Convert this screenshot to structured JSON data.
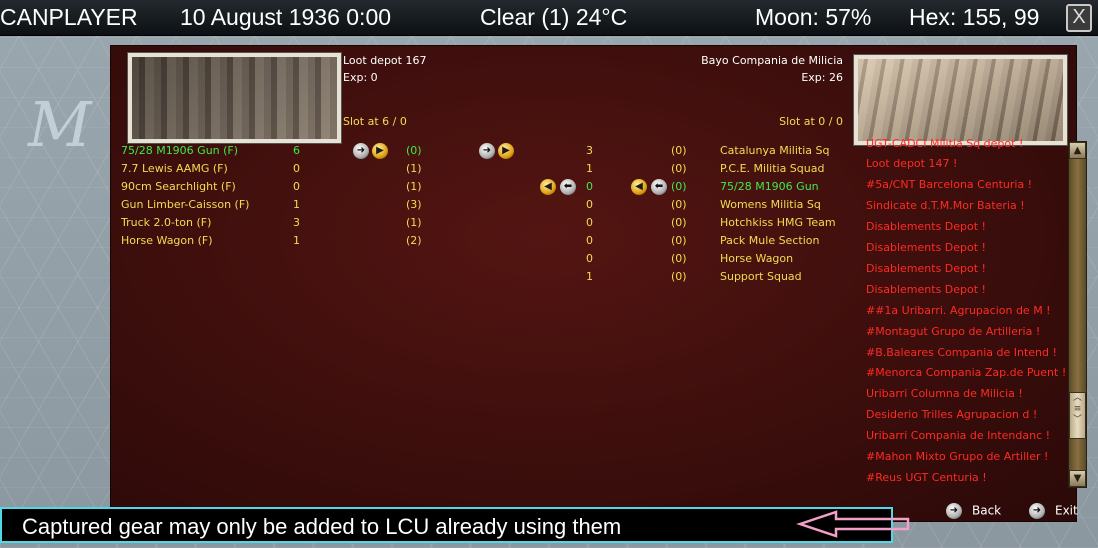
{
  "topbar": {
    "player": "CANPLAYER",
    "date": "10 August 1936 0:00",
    "weather": "Clear (1) 24°C",
    "moon": "Moon: 57%",
    "hex": "Hex: 155, 99",
    "close_icon": "X"
  },
  "map": {
    "letter": "M"
  },
  "source_unit": {
    "name": "Loot depot 167",
    "exp": "Exp: 0",
    "slots": "Slot at 6 / 0"
  },
  "target_unit": {
    "name": "Bayo Compania de Milicia",
    "exp": "Exp: 26",
    "slots": "Slot at 0 / 0"
  },
  "left_rows": [
    {
      "name": "75/28 M1906 Gun (F)",
      "qty": "6",
      "cnt": "(0)",
      "color": "green"
    },
    {
      "name": "7.7 Lewis AAMG (F)",
      "qty": "0",
      "cnt": "(1)",
      "color": "yellow"
    },
    {
      "name": "90cm Searchlight (F)",
      "qty": "0",
      "cnt": "(1)",
      "color": "yellow"
    },
    {
      "name": "Gun Limber-Caisson (F)",
      "qty": "1",
      "cnt": "(3)",
      "color": "yellow"
    },
    {
      "name": "Truck 2.0-ton (F)",
      "qty": "3",
      "cnt": "(1)",
      "color": "yellow"
    },
    {
      "name": "Horse Wagon (F)",
      "qty": "1",
      "cnt": "(2)",
      "color": "yellow"
    }
  ],
  "right_rows": [
    {
      "name": "Catalunya Militia Sq",
      "qty": "3",
      "cnt": "(0)",
      "color": "yellow"
    },
    {
      "name": "P.C.E. Militia Squad",
      "qty": "1",
      "cnt": "(0)",
      "color": "yellow"
    },
    {
      "name": "75/28 M1906 Gun",
      "qty": "0",
      "cnt": "(0)",
      "color": "green"
    },
    {
      "name": "Womens Militia Sq",
      "qty": "0",
      "cnt": "(0)",
      "color": "yellow"
    },
    {
      "name": "Hotchkiss HMG Team",
      "qty": "0",
      "cnt": "(0)",
      "color": "yellow"
    },
    {
      "name": "Pack Mule Section",
      "qty": "0",
      "cnt": "(0)",
      "color": "yellow"
    },
    {
      "name": "Horse Wagon",
      "qty": "0",
      "cnt": "(0)",
      "color": "yellow"
    },
    {
      "name": "Support Squad",
      "qty": "1",
      "cnt": "(0)",
      "color": "yellow"
    }
  ],
  "unit_list": [
    "UGT-CADCI Militia Sq depot !",
    "Loot depot 147 !",
    "#5a/CNT Barcelona Centuria !",
    "Sindicate d.T.M.Mor Bateria !",
    "Disablements Depot !",
    "Disablements Depot !",
    "Disablements Depot !",
    "Disablements Depot !",
    "##1a Uribarri. Agrupacion de M !",
    "#Montagut Grupo de Artilleria !",
    "#B.Baleares Compania de Intend !",
    "#Menorca Compania Zap.de Puent !",
    "Uribarri Columna de Milicia !",
    "Desiderio Trilles Agrupacion d !",
    "Uribarri Compania de Intendanc !",
    "#Mahon Mixto Grupo de Artiller !",
    "#Reus UGT Centuria !"
  ],
  "nav": {
    "back": "Back",
    "exit": "Exit"
  },
  "tooltip": "Captured gear may only be added to LCU already using them",
  "colors": {
    "yellow": "#f3dc52",
    "green": "#42e84a",
    "red": "#ff2a24",
    "tooltip_border": "#4fd8e6"
  }
}
